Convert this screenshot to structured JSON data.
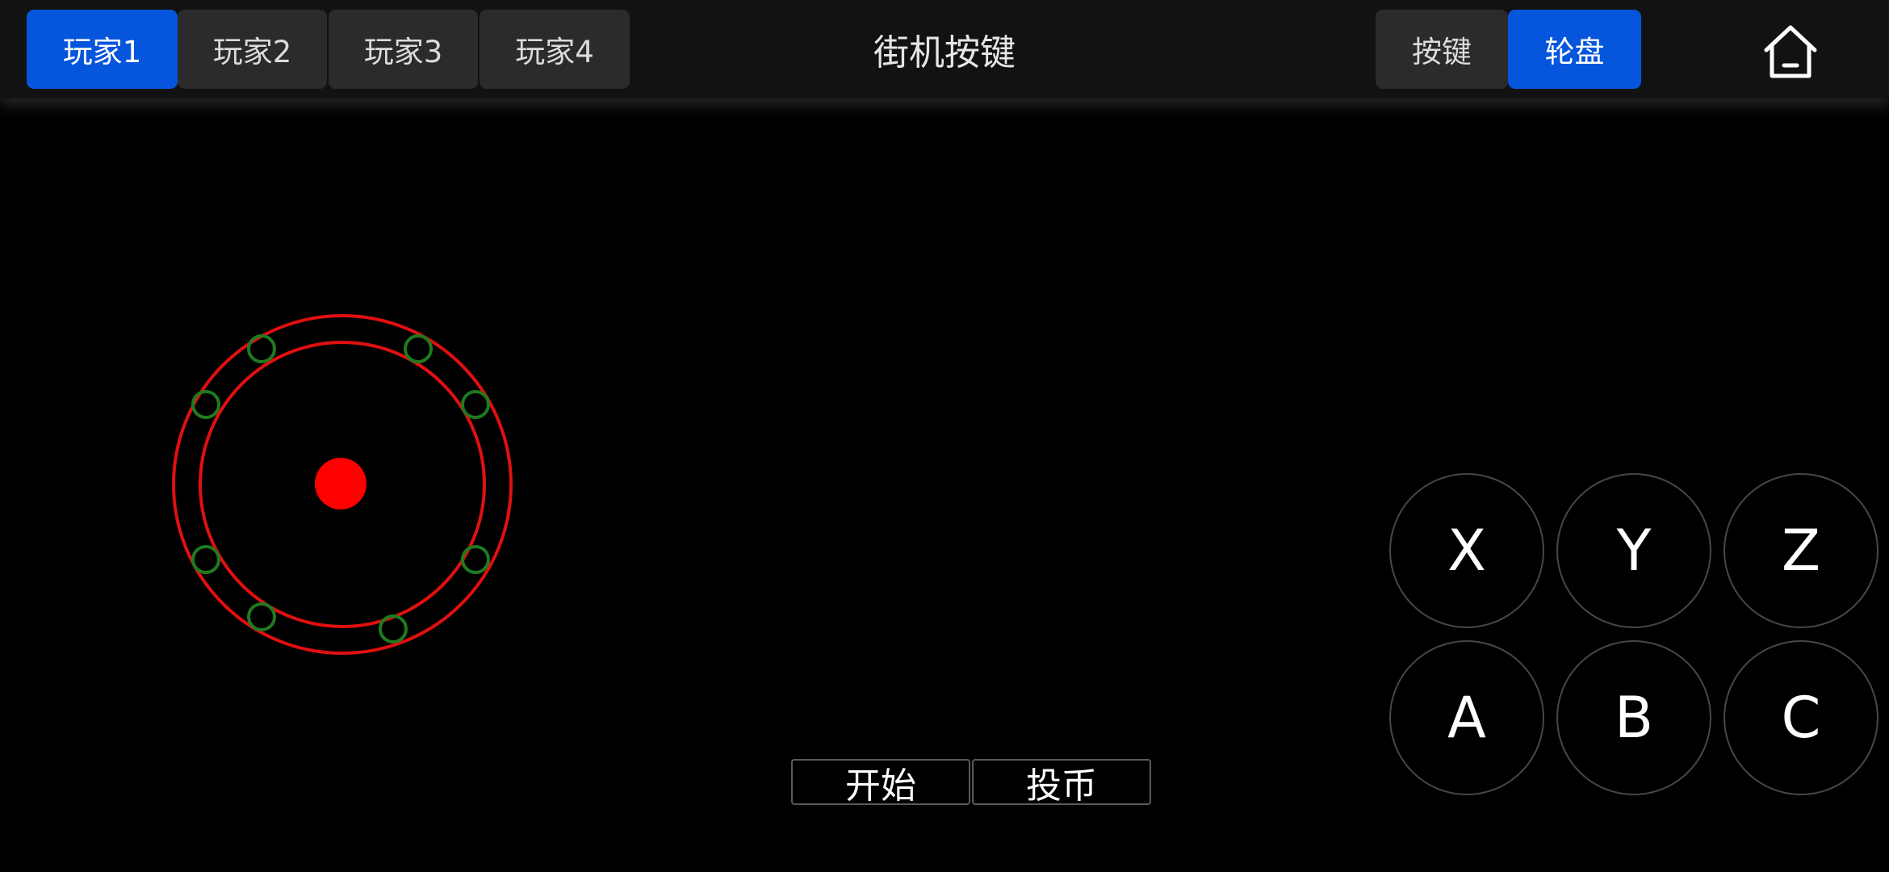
{
  "header": {
    "title": "街机按键",
    "player_tabs": [
      {
        "label": "玩家1",
        "active": true
      },
      {
        "label": "玩家2",
        "active": false
      },
      {
        "label": "玩家3",
        "active": false
      },
      {
        "label": "玩家4",
        "active": false
      }
    ],
    "mode_tabs": [
      {
        "label": "按键",
        "active": false
      },
      {
        "label": "轮盘",
        "active": true
      }
    ],
    "home_icon": "home-icon"
  },
  "controls": {
    "action_buttons": [
      "X",
      "Y",
      "Z",
      "A",
      "B",
      "C"
    ],
    "start_label": "开始",
    "coin_label": "投币"
  },
  "colors": {
    "accent": "#0655dd",
    "tab_inactive": "#2b2b2b",
    "topbar": "#121212",
    "joystick_ring": "#e01010",
    "joystick_knob": "#ff0000",
    "direction_marker": "#1f7a1f",
    "button_border": "#474747"
  }
}
